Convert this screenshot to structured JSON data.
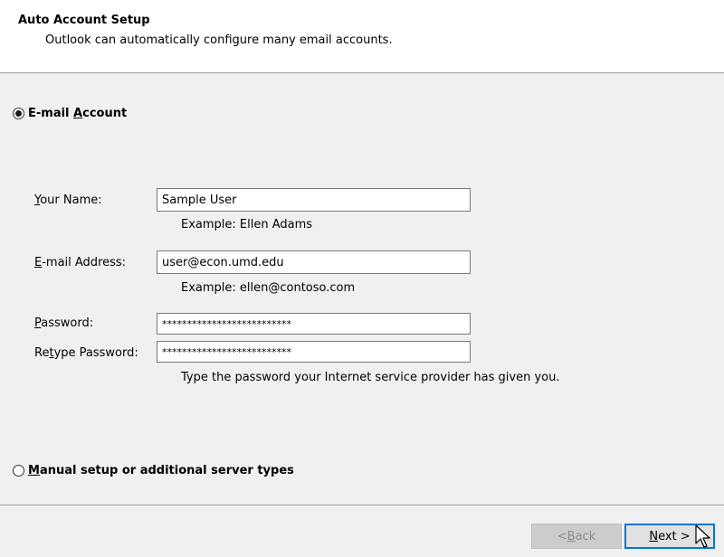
{
  "header": {
    "title": "Auto Account Setup",
    "subtitle": "Outlook can automatically configure many email accounts."
  },
  "email_option": {
    "label_pre": "E-mail ",
    "label_access": "A",
    "label_post": "ccount",
    "selected": true
  },
  "fields": {
    "name": {
      "label_access": "Y",
      "label_rest": "our Name:",
      "value": "Sample User",
      "example": "Example: Ellen Adams"
    },
    "email": {
      "label_access": "E",
      "label_rest": "-mail Address:",
      "value": "user@econ.umd.edu",
      "example": "Example: ellen@contoso.com"
    },
    "password": {
      "label_access": "P",
      "label_rest": "assword:",
      "value": "**************************"
    },
    "retype": {
      "label_pre": "Re",
      "label_access": "t",
      "label_rest": "ype Password:",
      "value": "**************************"
    },
    "password_hint": "Type the password your Internet service provider has given you."
  },
  "manual_option": {
    "label_access": "M",
    "label_rest": "anual setup or additional server types",
    "selected": false
  },
  "buttons": {
    "back_pre": "< ",
    "back_access": "B",
    "back_rest": "ack",
    "next_access": "N",
    "next_rest": "ext >"
  },
  "colors": {
    "focus_border": "#0078d7",
    "dialog_bg": "#f0f0f0",
    "header_bg": "#ffffff"
  }
}
